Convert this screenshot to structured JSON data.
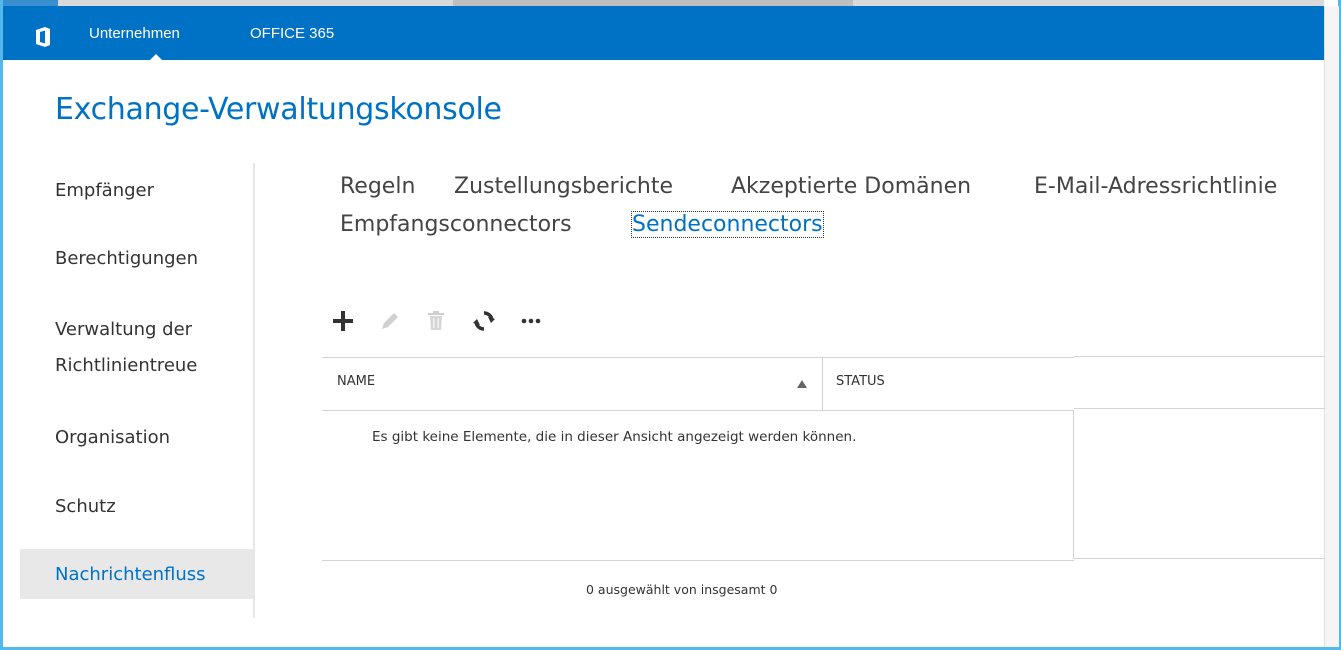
{
  "topbar": {
    "links": [
      "Unternehmen",
      "OFFICE 365"
    ],
    "active_link": "Unternehmen",
    "colors": {
      "bar": "#0072c6",
      "text": "#ffffff"
    }
  },
  "page_title": "Exchange-Verwaltungskonsole",
  "sidebar": {
    "items": [
      {
        "label": "Empfänger"
      },
      {
        "label": "Berechtigungen"
      },
      {
        "label": "Verwaltung der Richtlinientreue",
        "line1": "Verwaltung der",
        "line2": "Richtlinientreue"
      },
      {
        "label": "Organisation"
      },
      {
        "label": "Schutz"
      },
      {
        "label": "Nachrichtenfluss"
      }
    ],
    "selected": "Nachrichtenfluss"
  },
  "tabs": {
    "items": [
      "Regeln",
      "Zustellungsberichte",
      "Akzeptierte Domänen",
      "E-Mail-Adressrichtlinie",
      "Empfangsconnectors",
      "Sendeconnectors"
    ],
    "selected": "Sendeconnectors"
  },
  "toolbar": {
    "buttons": [
      {
        "icon": "plus-icon",
        "enabled": true
      },
      {
        "icon": "pencil-icon",
        "enabled": false
      },
      {
        "icon": "trash-icon",
        "enabled": false
      },
      {
        "icon": "refresh-icon",
        "enabled": true
      },
      {
        "icon": "more-icon",
        "enabled": true
      }
    ]
  },
  "table": {
    "columns": [
      "NAME",
      "STATUS"
    ],
    "sort_column": "NAME",
    "sort_direction": "ascending",
    "rows": [],
    "empty_message": "Es gibt keine Elemente, die in dieser Ansicht angezeigt werden können."
  },
  "status_text": "0 ausgewählt von insgesamt 0",
  "colors": {
    "accent": "#0072c6",
    "frame": "#55b8ea"
  }
}
